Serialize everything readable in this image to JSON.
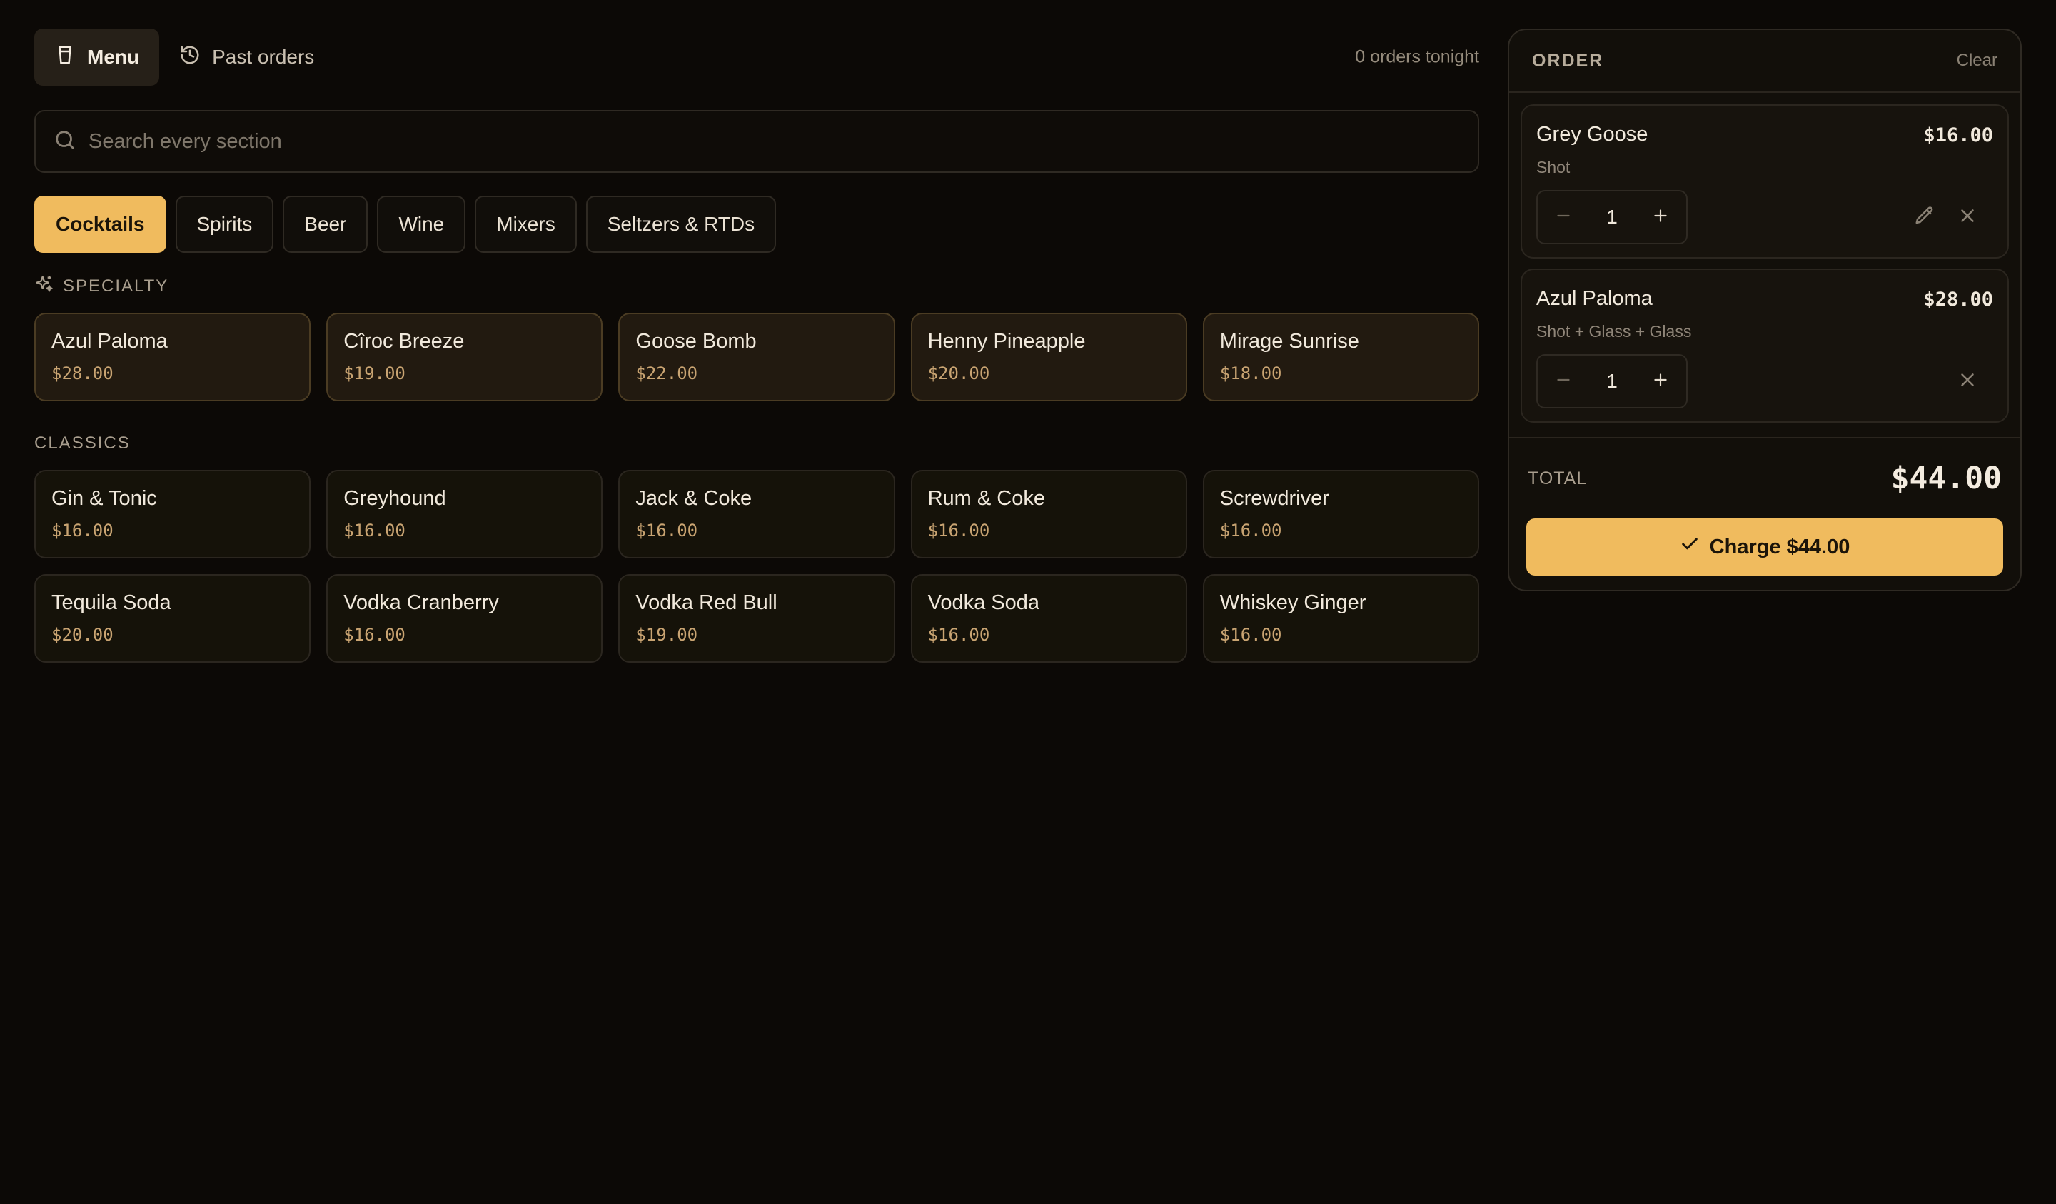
{
  "nav": {
    "menu_label": "Menu",
    "past_orders_label": "Past orders",
    "orders_count": "0 orders tonight"
  },
  "search": {
    "placeholder": "Search every section",
    "value": ""
  },
  "tabs": [
    "Cocktails",
    "Spirits",
    "Beer",
    "Wine",
    "Mixers",
    "Seltzers & RTDs"
  ],
  "active_tab": "Cocktails",
  "sections": {
    "specialty": {
      "label": "SPECIALTY",
      "items": [
        {
          "name": "Azul Paloma",
          "price": "$28.00"
        },
        {
          "name": "Cîroc Breeze",
          "price": "$19.00"
        },
        {
          "name": "Goose Bomb",
          "price": "$22.00"
        },
        {
          "name": "Henny Pineapple",
          "price": "$20.00"
        },
        {
          "name": "Mirage Sunrise",
          "price": "$18.00"
        }
      ]
    },
    "classics": {
      "label": "CLASSICS",
      "items": [
        {
          "name": "Gin & Tonic",
          "price": "$16.00"
        },
        {
          "name": "Greyhound",
          "price": "$16.00"
        },
        {
          "name": "Jack & Coke",
          "price": "$16.00"
        },
        {
          "name": "Rum & Coke",
          "price": "$16.00"
        },
        {
          "name": "Screwdriver",
          "price": "$16.00"
        },
        {
          "name": "Tequila Soda",
          "price": "$20.00"
        },
        {
          "name": "Vodka Cranberry",
          "price": "$16.00"
        },
        {
          "name": "Vodka Red Bull",
          "price": "$19.00"
        },
        {
          "name": "Vodka Soda",
          "price": "$16.00"
        },
        {
          "name": "Whiskey Ginger",
          "price": "$16.00"
        }
      ]
    }
  },
  "order": {
    "title": "ORDER",
    "clear_label": "Clear",
    "items": [
      {
        "name": "Grey Goose",
        "price": "$16.00",
        "detail": "Shot",
        "qty": "1",
        "editable": true
      },
      {
        "name": "Azul Paloma",
        "price": "$28.00",
        "detail": "Shot + Glass + Glass",
        "qty": "1",
        "editable": false
      }
    ],
    "total_label": "TOTAL",
    "total": "$44.00",
    "charge_label": "Charge $44.00"
  },
  "colors": {
    "background": "#0c0906",
    "accent": "#f0bb5e",
    "price_text": "#c9a472"
  },
  "icons": {
    "menu": "cup-icon",
    "past_orders": "history-icon",
    "search": "search-icon",
    "specialty": "sparkles-icon",
    "minus": "minus-icon",
    "plus": "plus-icon",
    "edit": "pencil-icon",
    "remove": "close-icon",
    "charge": "check-icon"
  }
}
